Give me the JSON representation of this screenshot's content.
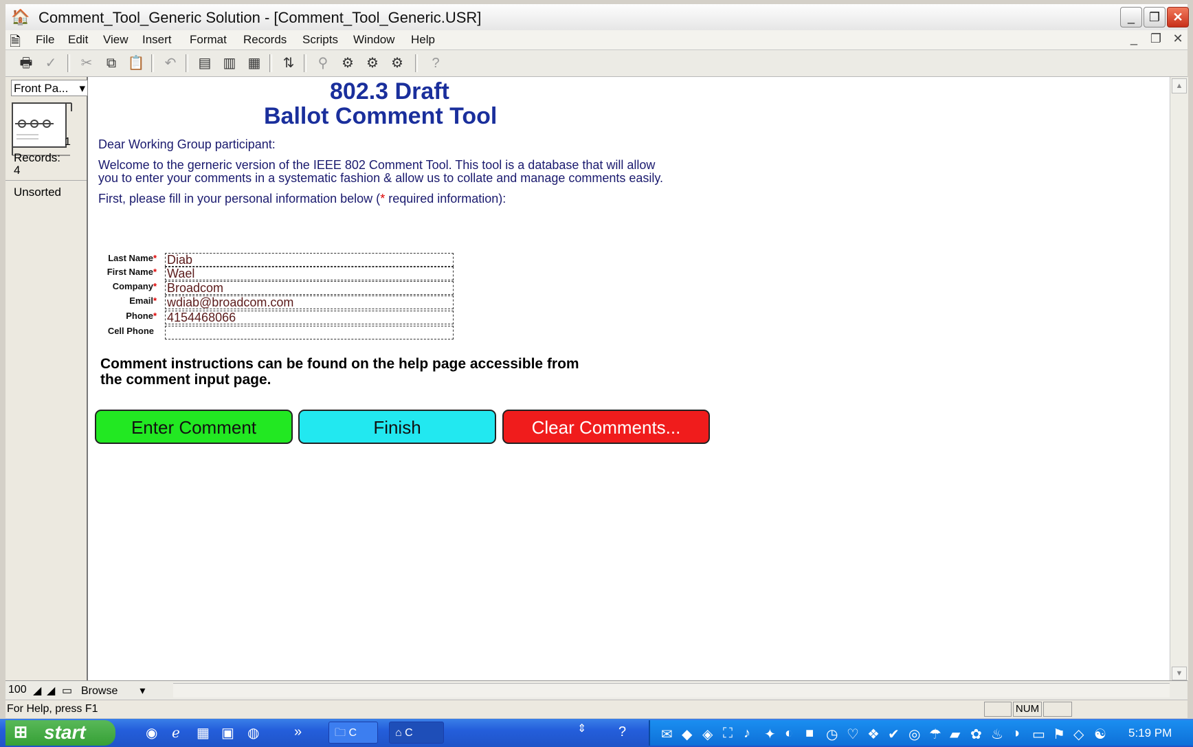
{
  "window": {
    "title": "Comment_Tool_Generic Solution - [Comment_Tool_Generic.USR]",
    "minimize": "_",
    "restore": "❐",
    "close": "✕"
  },
  "menu": {
    "items": [
      "File",
      "Edit",
      "View",
      "Insert",
      "Format",
      "Records",
      "Scripts",
      "Window",
      "Help"
    ],
    "mdi_min": "_",
    "mdi_restore": "❐",
    "mdi_close": "✕"
  },
  "status_area": {
    "layout": "Front Pa...",
    "page_number": "1",
    "records_label": "Records:",
    "records_count": "4",
    "sort_state": "Unsorted"
  },
  "page": {
    "title_line1": "802.3  Draft",
    "title_line2": "Ballot Comment Tool",
    "greeting": "Dear Working Group participant:",
    "welcome_line1": "Welcome to the gerneric version of the IEEE 802 Comment Tool. This tool is a database that will allow",
    "welcome_line2": "you to enter your comments in a systematic fashion & allow us to collate and manage comments easily.",
    "fill_in_before": "First, please fill in your personal information below (",
    "fill_in_star": "*",
    "fill_in_after": " required information):",
    "fields": [
      {
        "label": "Last Name",
        "required": "*",
        "value": "Diab"
      },
      {
        "label": "First Name",
        "required": "*",
        "value": "Wael"
      },
      {
        "label": "Company",
        "required": "*",
        "value": "Broadcom"
      },
      {
        "label": "Email",
        "required": "*",
        "value": "wdiab@broadcom.com"
      },
      {
        "label": "Phone",
        "required": "*",
        "value": "4154468066"
      },
      {
        "label": "Cell Phone",
        "required": "",
        "value": ""
      }
    ],
    "instructions_line1": "Comment instructions can be found on the help page accessible from",
    "instructions_line2": "the comment input page.",
    "buttons": {
      "enter_comment": "Enter Comment",
      "finish": "Finish",
      "clear_comments": "Clear Comments..."
    },
    "colors": {
      "heading": "#1a2f9c",
      "enter_comment": "#22e822",
      "finish": "#22e8f0",
      "clear_comments": "#f01c1c"
    }
  },
  "bottom_bar": {
    "zoom": "100",
    "mode": "Browse"
  },
  "statusbar": {
    "help_text": "For Help, press F1",
    "num_indicator": "NUM"
  },
  "taskbar": {
    "start_label": "start",
    "task1_label": "C",
    "task2_label": "C",
    "clock": "5:19 PM"
  }
}
